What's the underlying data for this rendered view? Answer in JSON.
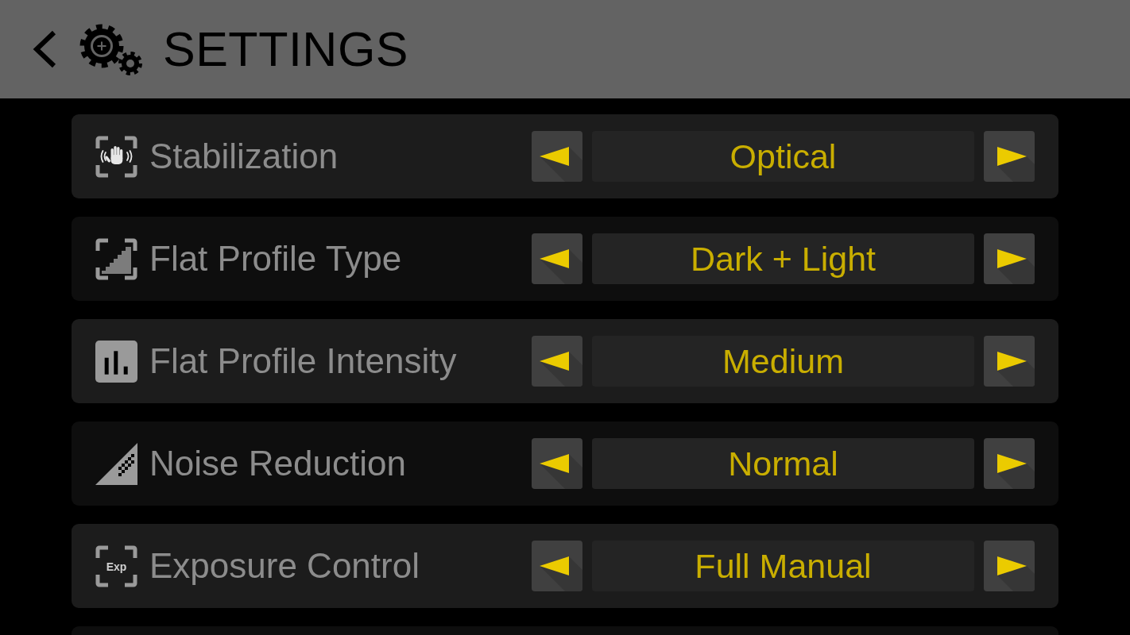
{
  "header": {
    "title": "SETTINGS"
  },
  "settings": [
    {
      "label": "Stabilization",
      "value": "Optical"
    },
    {
      "label": "Flat Profile Type",
      "value": "Dark + Light"
    },
    {
      "label": "Flat Profile Intensity",
      "value": "Medium"
    },
    {
      "label": "Noise Reduction",
      "value": "Normal"
    },
    {
      "label": "Exposure Control",
      "value": "Full Manual",
      "icon_text": "Exp"
    }
  ]
}
